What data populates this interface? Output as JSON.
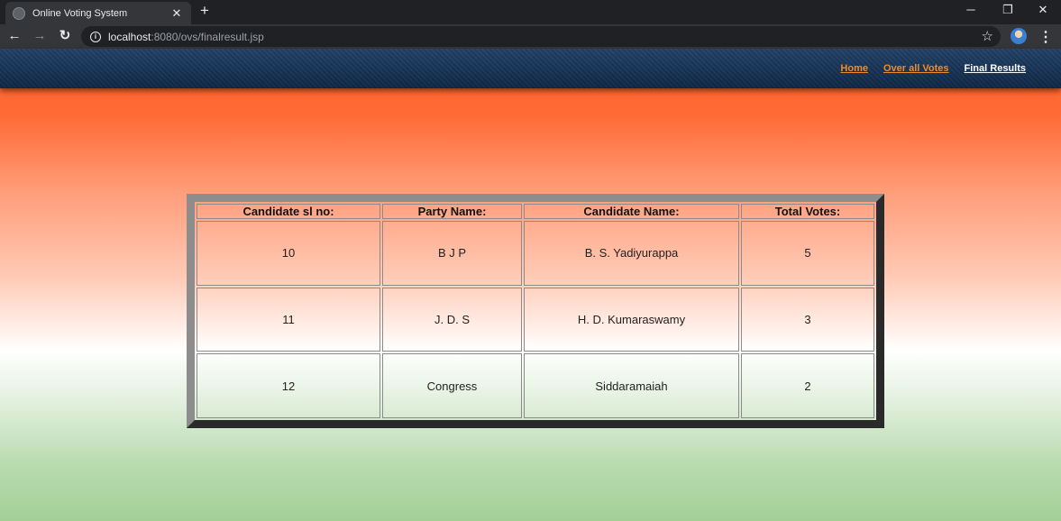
{
  "browser": {
    "tab_title": "Online Voting System",
    "url_host": "localhost",
    "url_rest": ":8080/ovs/finalresult.jsp"
  },
  "nav": {
    "home": "Home",
    "overall_votes": "Over all Votes",
    "final_results": "Final Results"
  },
  "results": {
    "headers": [
      "Candidate sl no:",
      "Party Name:",
      "Candidate Name:",
      "Total Votes:"
    ],
    "rows": [
      [
        "10",
        "B J P",
        "B. S. Yadiyurappa",
        "5"
      ],
      [
        "11",
        "J. D. S",
        "H. D. Kumaraswamy",
        "3"
      ],
      [
        "12",
        "Congress",
        "Siddaramaiah",
        "2"
      ]
    ]
  },
  "colors": {
    "nav_link": "#f08a2c",
    "nav_active": "#ffffff",
    "saffron": "#ff6630",
    "green": "#a3cf95"
  },
  "icons": [
    "globe-icon",
    "close-icon",
    "plus-icon",
    "back-icon",
    "forward-icon",
    "reload-icon",
    "info-icon",
    "star-icon",
    "menu-icon"
  ]
}
